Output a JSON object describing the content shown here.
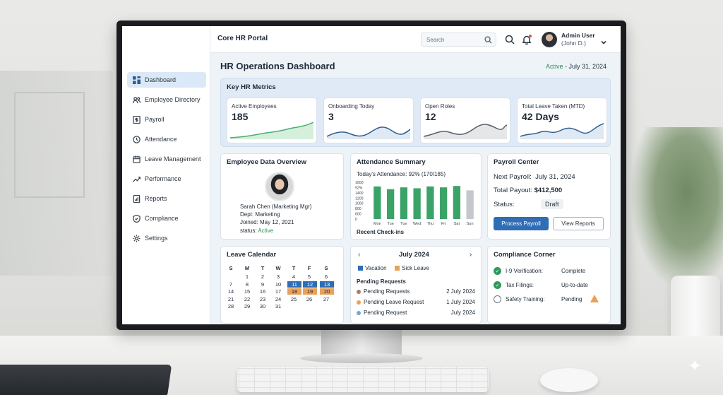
{
  "app": {
    "title": "Core HR Portal"
  },
  "sidebar": {
    "items": [
      {
        "label": "Dashboard",
        "icon": "dashboard-icon",
        "active": true
      },
      {
        "label": "Employee Directory",
        "icon": "people-icon"
      },
      {
        "label": "Payroll",
        "icon": "payroll-icon"
      },
      {
        "label": "Attendance",
        "icon": "clock-icon"
      },
      {
        "label": "Leave Management",
        "icon": "calendar-icon"
      },
      {
        "label": "Performance",
        "icon": "trend-icon"
      },
      {
        "label": "Reports",
        "icon": "reports-icon"
      },
      {
        "label": "Compliance",
        "icon": "shield-icon"
      },
      {
        "label": "Settings",
        "icon": "gear-icon"
      }
    ]
  },
  "header": {
    "search_placeholder": "Search",
    "user_name": "Admin User",
    "user_sub": "(John D.)"
  },
  "page": {
    "title": "HR Operations Dashboard",
    "status_active": "Active",
    "status_date": " - July 31, 2024"
  },
  "metrics": {
    "title": "Key HR Metrics",
    "cards": [
      {
        "label": "Active Employees",
        "value": "185",
        "color": "#4caf72",
        "fill": "#d6efdd"
      },
      {
        "label": "Onboarding Today",
        "value": "3",
        "color": "#2f5f8f",
        "fill": "#dfe9f4"
      },
      {
        "label": "Open Roles",
        "value": "12",
        "color": "#5a6068",
        "fill": "#e4e6e8"
      },
      {
        "label": "Total Leave Taken (MTD)",
        "value": "42 Days",
        "color": "#2f5f8f",
        "fill": "#dfe9f4"
      }
    ]
  },
  "employee": {
    "title": "Employee Data Overview",
    "name": "Sarah Chen (Marketing Mgr)",
    "dept": "Dept: Marketing",
    "joined": "Joined: May 12, 2021",
    "status_label": "status: ",
    "status_value": "Active"
  },
  "attendance": {
    "title": "Attendance Summary",
    "subtitle": "Today's Attendance: 92% (170/185)",
    "recent": "Recent Check-ins"
  },
  "chart_data": {
    "type": "bar",
    "categories": [
      "Mon",
      "Tue",
      "Tue",
      "Wed",
      "Thu",
      "Fri",
      "Sat",
      "Sun"
    ],
    "values": [
      1420,
      1300,
      1380,
      1340,
      1420,
      1380,
      1440,
      1250
    ],
    "ylim": [
      0,
      1600
    ],
    "yticks": [
      "1600",
      "92%",
      "1400",
      "1200",
      "1000",
      "800",
      "600",
      "0"
    ],
    "bar_colors": [
      "#3aa468",
      "#3aa468",
      "#3aa468",
      "#3aa468",
      "#3aa468",
      "#3aa468",
      "#3aa468",
      "#c4c8cc"
    ]
  },
  "payroll": {
    "title": "Payroll Center",
    "next_label": "Next Payroll:",
    "next_value": "July 31, 2024",
    "payout_label": "Total Payout:",
    "payout_value": "$412,500",
    "status_label": "Status:",
    "status_value": "Draft",
    "process_btn": "Process Payroll",
    "reports_btn": "View Reports"
  },
  "leave_calendar": {
    "title": "Leave Calendar",
    "headers": [
      "S",
      "M",
      "T",
      "W",
      "T",
      "F",
      "S"
    ],
    "weeks": [
      [
        "",
        "1",
        "2",
        "3",
        "4",
        "5",
        "6"
      ],
      [
        "7",
        "8",
        "9",
        "10",
        "11",
        "12",
        "13"
      ],
      [
        "14",
        "15",
        "16",
        "17",
        "18",
        "19",
        "20"
      ],
      [
        "21",
        "22",
        "23",
        "24",
        "25",
        "26",
        "27"
      ],
      [
        "28",
        "29",
        "30",
        "31",
        "",
        "",
        ""
      ]
    ]
  },
  "month_panel": {
    "prev": "‹",
    "month": "July 2024",
    "next": "›",
    "legend_vacation": "Vacation",
    "legend_sick": "Sick Leave",
    "pending_title": "Pending Requests",
    "rows": [
      {
        "label": "Pending Requests",
        "date": "2 July 2024",
        "color": "#a0826d"
      },
      {
        "label": "Pending Leave Request",
        "date": "1 July 2024",
        "color": "#e9a15a"
      },
      {
        "label": "Pending Request",
        "date": "July 2024",
        "color": "#6ea8d6"
      }
    ]
  },
  "compliance": {
    "title": "Compliance Corner",
    "rows": [
      {
        "label": "I-9 Verification:",
        "status": "Complete"
      },
      {
        "label": "Tax Filings:",
        "status": "Up-to-date"
      },
      {
        "label": "Safety Training:",
        "status": "Pending"
      }
    ]
  }
}
